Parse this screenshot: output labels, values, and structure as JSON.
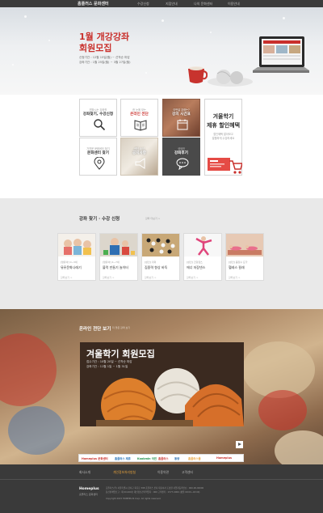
{
  "topnav": {
    "brand": "홈플러스 문화센터",
    "menu": [
      "수강신청",
      "지점안내",
      "나의 문화센터",
      "이용안내"
    ]
  },
  "hero": {
    "title_line1": "1월 개강강좌",
    "title_line2": "회원모집",
    "period1": "신청기간 : 12월 15일(월) ~ 선착순 마감",
    "period2": "강좌기간 : 1월 25일(월) ~ 3월 27일(월)"
  },
  "quick": {
    "search": {
      "sub": "원하시는 강좌를",
      "label": "강좌찾기, 수강신청",
      "icon": "search-icon"
    },
    "intro": {
      "sub": "한 눈에 보는",
      "label": "온라인 전단",
      "icon": "book-icon"
    },
    "schedule": {
      "sub": "이번달 강좌는?",
      "label": "강의 시간표",
      "icon": "calendar-icon"
    },
    "discount": {
      "line1": "겨울학기",
      "line2": "제휴 할인혜택",
      "sub1": "할인혜택 알아보고",
      "sub2": "알뜰하게 수강하세요",
      "icon": "cart-icon"
    },
    "center": {
      "sub": "가까운 문화센터 찾기",
      "label": "문화센터 찾기",
      "icon": "location-icon"
    },
    "notice": {
      "sub": "센터 소식",
      "label": "공지사항",
      "icon": "megaphone-icon"
    },
    "review": {
      "sub": "생생한",
      "label": "강좌후기",
      "icon": "chat-icon"
    }
  },
  "courses": {
    "title": "강좌 찾기 · 수강 신청",
    "subtitle": "강좌 더보기 >",
    "cards": [
      {
        "cat": "[영유아] 0~3세",
        "name": "뮤뮤문화나래기",
        "meta": "강좌보기 >"
      },
      {
        "cat": "[영유아] 4~7세",
        "name": "블럭 만들기 놀이터",
        "meta": "강좌보기 >"
      },
      {
        "cat": "[성인] 취미",
        "name": "집중력 향상 바둑",
        "meta": "강좌보기 >"
      },
      {
        "cat": "[성인] 건강댄스",
        "name": "에너 저장댄스",
        "meta": "강좌보기 >"
      },
      {
        "cat": "[성인] 몸장수 요가",
        "name": "헬레스 필래",
        "meta": "강좌보기 >"
      }
    ]
  },
  "lecture": {
    "title": "온라인 전단 보기",
    "subtitle": "더 많은 강좌 보기",
    "video_title": "겨울학기 회원모집",
    "video_line1": "접수기간 : 10월 20일 ~ 선착순 마감",
    "video_line2": "강좌기간 : 11월 1일 ~ 1월 31일"
  },
  "partners": [
    "Homeplus 문화센터",
    "홈플러스 제휴",
    "Kookmin 국민",
    "홈플러스",
    "동양",
    "홈플러스몰",
    "Homeplus"
  ],
  "footer": {
    "menu": [
      "회사소개",
      "개인정보처리방침",
      "이용약관",
      "고객센터"
    ],
    "logo": "Homeplus",
    "logo_sub": "홈플러스 문화센터",
    "address": [
      "홈플러스(주) 서울특별시 강서구 화곡로 398 홈플러스 본사 대표이사 도성환 사업자등록번호 : 000-00-00000",
      "통신판매업신고 : 제 00-000호 개인정보관리책임자 : 000 고객센터 : 1577-0000 (평일 09:00~18:00)",
      "Copyright 2015 HOMEPLUS Corp. All rights reserved."
    ]
  },
  "colors": {
    "accent": "#c9302c",
    "dark": "#3b3b3b",
    "footer_accent": "#e8a23a"
  }
}
